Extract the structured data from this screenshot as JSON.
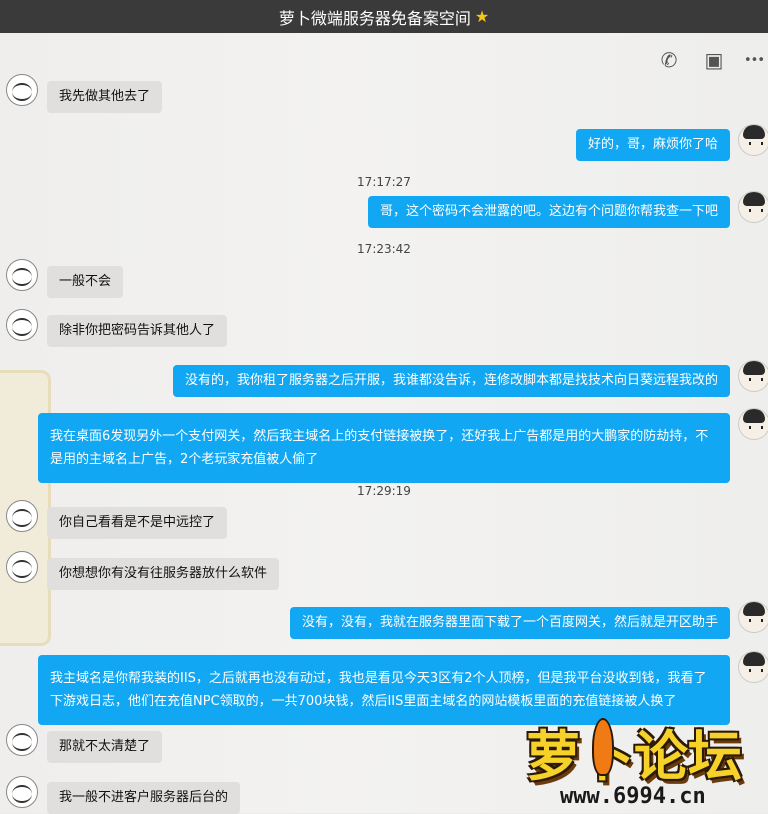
{
  "window": {
    "title": "萝卜微端服务器免备案空间",
    "title_star": "★"
  },
  "toolbar": {
    "call_icon": "✆",
    "video_icon": "▣",
    "more_icon": "•••"
  },
  "messages": [
    {
      "side": "left",
      "text": "我先做其他去了"
    },
    {
      "side": "right",
      "text": "好的，哥，麻烦你了哈"
    },
    {
      "side": "right",
      "text": "哥，这个密码不会泄露的吧。这边有个问题你帮我查一下吧"
    },
    {
      "side": "left",
      "text": "一般不会"
    },
    {
      "side": "left",
      "text": "除非你把密码告诉其他人了"
    },
    {
      "side": "right",
      "text": "没有的，我你租了服务器之后开服，我谁都没告诉，连修改脚本都是找技术向日葵远程我改的"
    },
    {
      "side": "right",
      "text": "我在桌面6发现另外一个支付网关，然后我主域名上的支付链接被换了，还好我上广告都是用的大鹏家的防劫持，不是用的主域名上广告，2个老玩家充值被人偷了"
    },
    {
      "side": "left",
      "text": "你自己看看是不是中远控了"
    },
    {
      "side": "left",
      "text": "你想想你有没有往服务器放什么软件"
    },
    {
      "side": "right",
      "text": "没有，没有，我就在服务器里面下载了一个百度网关，然后就是开区助手"
    },
    {
      "side": "right",
      "text": "我主域名是你帮我装的IIS，之后就再也没有动过，我也是看见今天3区有2个人顶榜，但是我平台没收到钱，我看了下游戏日志，他们在充值NPC领取的，一共700块钱，然后IIS里面主域名的网站模板里面的充值链接被人换了"
    },
    {
      "side": "left",
      "text": "那就不太清楚了"
    },
    {
      "side": "left",
      "text": "我一般不进客户服务器后台的"
    }
  ],
  "timestamps": [
    "17:17:27",
    "17:23:42",
    "17:29:19"
  ],
  "watermark": {
    "logo_text": "萝卜论坛",
    "site": "www.6994.cn"
  }
}
